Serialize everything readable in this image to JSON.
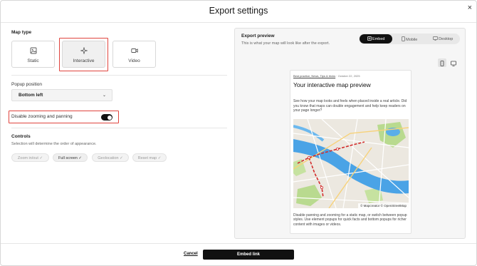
{
  "dialog": {
    "title": "Export settings",
    "close_glyph": "×"
  },
  "map_type": {
    "label": "Map type",
    "options": [
      {
        "label": "Static",
        "icon": "image-icon"
      },
      {
        "label": "Interactive",
        "icon": "sparkle-icon",
        "selected": true
      },
      {
        "label": "Video",
        "icon": "video-camera-icon"
      }
    ]
  },
  "popup_position": {
    "label": "Popup position",
    "value": "Bottom left",
    "chevron": "⌄"
  },
  "zoom_toggle": {
    "label": "Disable zooming and panning",
    "on": true
  },
  "controls": {
    "label": "Controls",
    "note": "Selection will determine the order of appearance.",
    "chips": [
      {
        "label": "Zoom in/out",
        "active": false
      },
      {
        "label": "Full screen",
        "active": true
      },
      {
        "label": "Geolocation",
        "active": false
      },
      {
        "label": "Reset map",
        "active": false
      }
    ],
    "check": "✓"
  },
  "preview": {
    "title": "Export preview",
    "subtitle": "This is what your map will look like after the export.",
    "tabs": [
      {
        "label": "Embed",
        "icon": "embed-icon",
        "active": true
      },
      {
        "label": "Mobile",
        "icon": "mobile-icon",
        "active": false
      },
      {
        "label": "Desktop",
        "icon": "desktop-icon",
        "active": false
      }
    ],
    "device_buttons": [
      {
        "icon": "mobile-device-icon",
        "active": true
      },
      {
        "icon": "desktop-device-icon",
        "active": false
      }
    ]
  },
  "article": {
    "breadcrumb": "Best practice, News, Tips & tricks",
    "date": "October 22, 2025",
    "title": "Your interactive map preview",
    "body": "See how your map looks and feels when placed inside a real article. Did you know that maps can double engagement and help keep readers on your page longer?",
    "attribution": "© Mapcreator © OpenStreetMap",
    "footer": "Disable panning and zooming for a static map, or switch between popup styles. Use element popups for quick facts and bottom popups for richer content with images or videos."
  },
  "footer": {
    "cancel_label": "Cancel",
    "primary_label": "Embed link"
  },
  "colors": {
    "accent": "#111111",
    "highlight": "#e0443e",
    "water": "#4aa3e6",
    "park": "#b5d88a",
    "route": "#d22b2b"
  }
}
